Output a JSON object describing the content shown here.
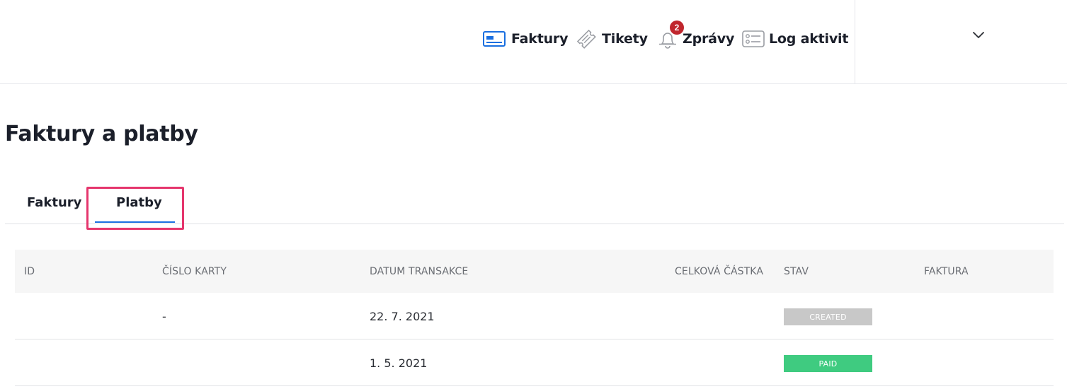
{
  "header": {
    "nav": [
      {
        "label": "Faktury",
        "icon": "invoice-card-icon",
        "color": "#1a6fe0"
      },
      {
        "label": "Tikety",
        "icon": "ticket-icon"
      },
      {
        "label": "Zprávy",
        "icon": "bell-icon",
        "badge": "2"
      },
      {
        "label": "Log aktivit",
        "icon": "activity-log-icon"
      }
    ],
    "dropdown_icon": "chevron-down-icon"
  },
  "page": {
    "title": "Faktury a platby"
  },
  "tabs": [
    {
      "label": "Faktury",
      "active": false
    },
    {
      "label": "Platby",
      "active": true
    }
  ],
  "table": {
    "columns": [
      "ID",
      "ČÍSLO KARTY",
      "DATUM TRANSAKCE",
      "CELKOVÁ ČÁSTKA",
      "STAV",
      "FAKTURA"
    ],
    "rows": [
      {
        "id": "",
        "card": "-",
        "date": "22. 7. 2021",
        "amount": "",
        "status": "CREATED",
        "status_color": "#c8c8c8",
        "invoice": ""
      },
      {
        "id": "",
        "card": "",
        "date": "1. 5. 2021",
        "amount": "",
        "status": "PAID",
        "status_color": "#3fcb80",
        "invoice": ""
      }
    ]
  },
  "colors": {
    "accent": "#1a6fe0",
    "badge": "#c0262d",
    "highlight": "#e5366d"
  }
}
